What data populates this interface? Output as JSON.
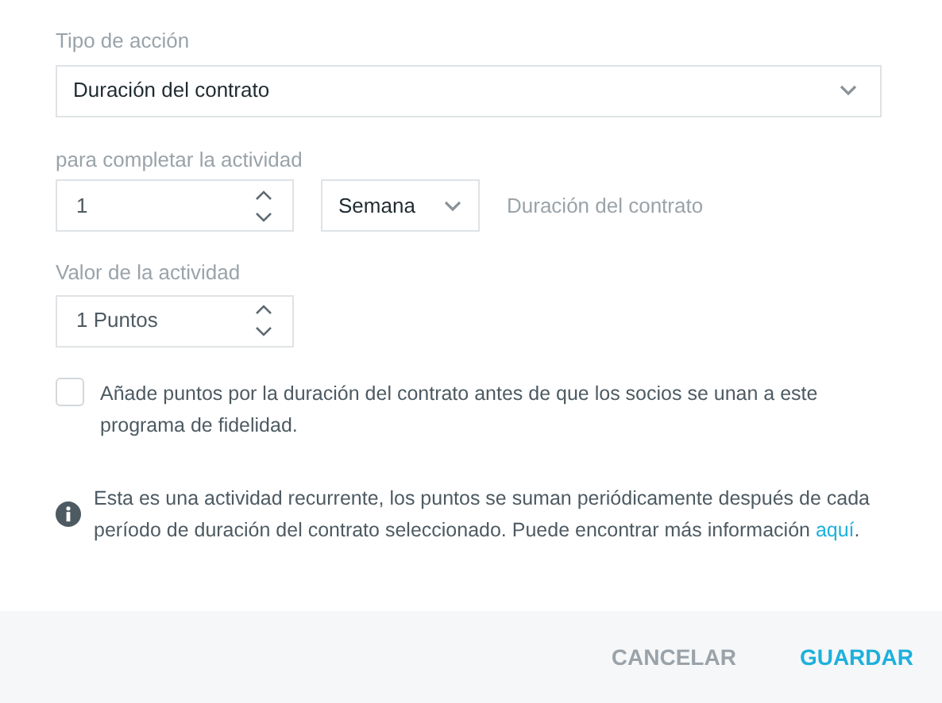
{
  "action_type": {
    "label": "Tipo de acción",
    "value": "Duración del contrato"
  },
  "completion": {
    "label": "para completar la actividad",
    "amount": "1",
    "unit": "Semana",
    "description": "Duración del contrato"
  },
  "activity_value": {
    "label": "Valor de la actividad",
    "value": "1 Puntos"
  },
  "retroactive": {
    "checked": false,
    "label": "Añade puntos por la duración del contrato antes de que los socios se unan a este programa de fidelidad."
  },
  "info": {
    "text": "Esta es una actividad recurrente, los puntos se suman periódicamente después de cada período de duración del contrato seleccionado. Puede encontrar más información ",
    "link": "aquí",
    "text_after": "."
  },
  "footer": {
    "buttons": [
      {
        "label": "CANCELAR",
        "kind": "secondary"
      },
      {
        "label": "GUARDAR",
        "kind": "primary"
      }
    ]
  }
}
